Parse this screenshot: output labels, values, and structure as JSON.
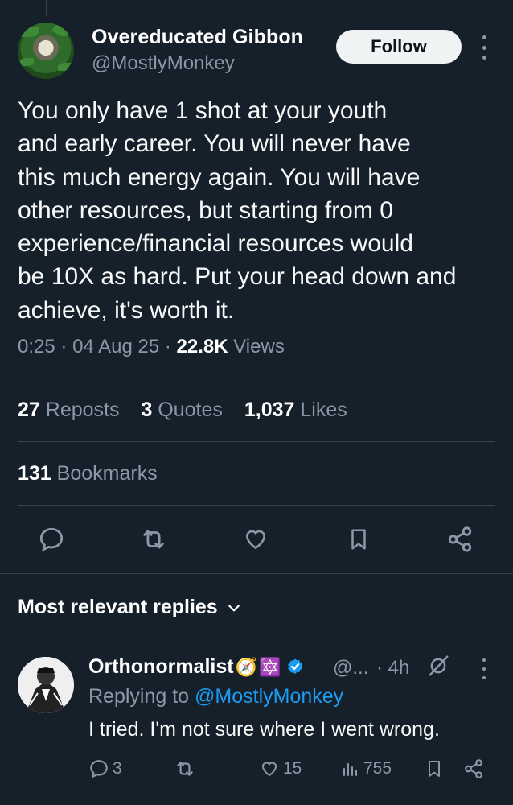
{
  "tweet": {
    "author_name": "Overeducated Gibbon",
    "author_handle": "@MostlyMonkey",
    "follow_label": "Follow",
    "text": "You only have 1 shot at your youth\nand early career. You will never have\nthis much energy again. You will have\nother resources, but starting from 0\nexperience/financial resources would\nbe 10X as hard. Put your head down and\nachieve, it's worth it.",
    "time": "0:25",
    "date": "04 Aug 25",
    "views_count": "22.8K",
    "views_label": "Views",
    "sep": "·"
  },
  "stats": {
    "reposts_count": "27",
    "reposts_label": "Reposts",
    "quotes_count": "3",
    "quotes_label": "Quotes",
    "likes_count": "1,037",
    "likes_label": "Likes",
    "bookmarks_count": "131",
    "bookmarks_label": "Bookmarks"
  },
  "actions": [
    "reply-icon",
    "repost-icon",
    "like-icon",
    "bookmark-icon",
    "share-icon"
  ],
  "replies_section": {
    "title": "Most relevant replies"
  },
  "reply": {
    "name": "Orthonormalist",
    "emoji_1": "🧭",
    "emoji_2": "🔯",
    "handle": "@...",
    "time": "· 4h",
    "replying_prefix": "Replying to",
    "replying_handle": "@MostlyMonkey",
    "text": "I tried. I'm not sure where I went wrong.",
    "reply_count": "3",
    "like_count": "15",
    "view_count": "755"
  },
  "colors": {
    "background": "#15202b",
    "muted": "#8b98a5",
    "link": "#1d9bf0",
    "divider": "#38444d"
  }
}
